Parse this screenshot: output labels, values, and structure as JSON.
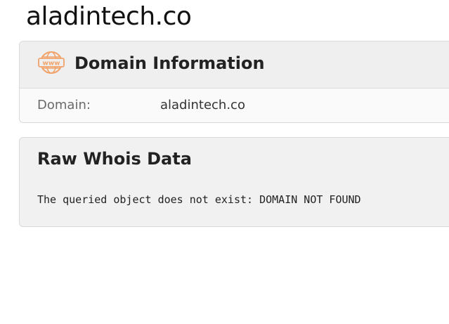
{
  "site": {
    "title": "aladintech.co"
  },
  "domain_info": {
    "icon": "www-icon",
    "icon_text": "www",
    "accent_color": "#f0a36a",
    "title": "Domain Information",
    "rows": [
      {
        "label": "Domain:",
        "value": "aladintech.co"
      }
    ]
  },
  "raw_whois": {
    "title": "Raw Whois Data",
    "text": "The queried object does not exist: DOMAIN NOT FOUND"
  }
}
